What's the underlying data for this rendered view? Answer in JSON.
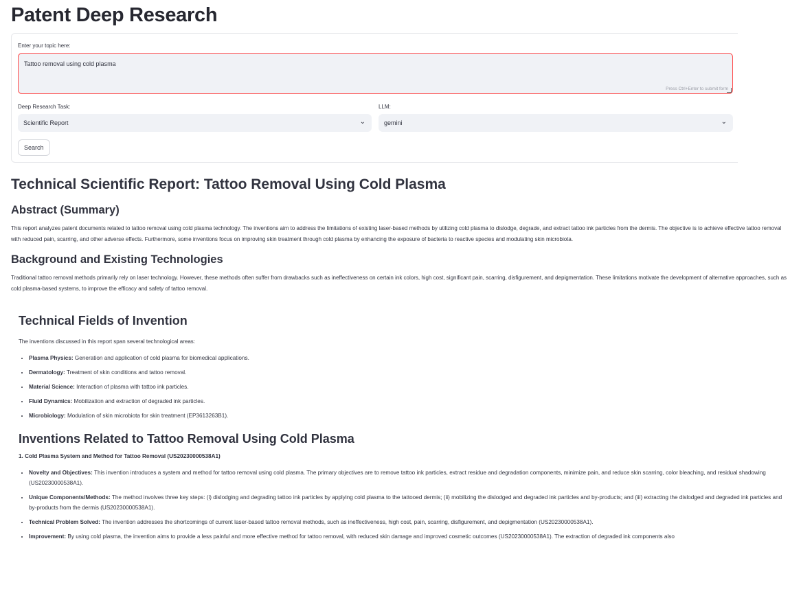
{
  "app": {
    "title": "Patent Deep Research"
  },
  "form": {
    "topic_label": "Enter your topic here:",
    "topic_value": "Tattoo removal using cold plasma",
    "submit_hint": "Press Ctrl+Enter to submit form",
    "task_label": "Deep Research Task:",
    "task_value": "Scientific Report",
    "llm_label": "LLM:",
    "llm_value": "gemini",
    "search_label": "Search"
  },
  "report": {
    "title": "Technical Scientific Report: Tattoo Removal Using Cold Plasma",
    "abstract_heading": "Abstract (Summary)",
    "abstract_text": "This report analyzes patent documents related to tattoo removal using cold plasma technology. The inventions aim to address the limitations of existing laser-based methods by utilizing cold plasma to dislodge, degrade, and extract tattoo ink particles from the dermis. The objective is to achieve effective tattoo removal with reduced pain, scarring, and other adverse effects. Furthermore, some inventions focus on improving skin treatment through cold plasma by enhancing the exposure of bacteria to reactive species and modulating skin microbiota.",
    "background_heading": "Background and Existing Technologies",
    "background_text": "Traditional tattoo removal methods primarily rely on laser technology. However, these methods often suffer from drawbacks such as ineffectiveness on certain ink colors, high cost, significant pain, scarring, disfigurement, and depigmentation. These limitations motivate the development of alternative approaches, such as cold plasma-based systems, to improve the efficacy and safety of tattoo removal.",
    "fields_heading": "Technical Fields of Invention",
    "fields_intro": "The inventions discussed in this report span several technological areas:",
    "fields": [
      {
        "term": "Plasma Physics:",
        "desc": " Generation and application of cold plasma for biomedical applications."
      },
      {
        "term": "Dermatology:",
        "desc": " Treatment of skin conditions and tattoo removal."
      },
      {
        "term": "Material Science:",
        "desc": " Interaction of plasma with tattoo ink particles."
      },
      {
        "term": "Fluid Dynamics:",
        "desc": " Mobilization and extraction of degraded ink particles."
      },
      {
        "term": "Microbiology:",
        "desc": " Modulation of skin microbiota for skin treatment (EP3613263B1)."
      }
    ],
    "inventions_heading": "Inventions Related to Tattoo Removal Using Cold Plasma",
    "patent1_heading": "1. Cold Plasma System and Method for Tattoo Removal (US20230000538A1)",
    "patent1_points": [
      {
        "term": "Novelty and Objectives:",
        "desc": " This invention introduces a system and method for tattoo removal using cold plasma. The primary objectives are to remove tattoo ink particles, extract residue and degradation components, minimize pain, and reduce skin scarring, color bleaching, and residual shadowing (US20230000538A1)."
      },
      {
        "term": "Unique Components/Methods:",
        "desc": " The method involves three key steps: (i) dislodging and degrading tattoo ink particles by applying cold plasma to the tattooed dermis; (ii) mobilizing the dislodged and degraded ink particles and by-products; and (iii) extracting the dislodged and degraded ink particles and by-products from the dermis (US20230000538A1)."
      },
      {
        "term": "Technical Problem Solved:",
        "desc": " The invention addresses the shortcomings of current laser-based tattoo removal methods, such as ineffectiveness, high cost, pain, scarring, disfigurement, and depigmentation (US20230000538A1)."
      },
      {
        "term": "Improvement:",
        "desc": " By using cold plasma, the invention aims to provide a less painful and more effective method for tattoo removal, with reduced skin damage and improved cosmetic outcomes (US20230000538A1). The extraction of degraded ink components also"
      }
    ]
  }
}
